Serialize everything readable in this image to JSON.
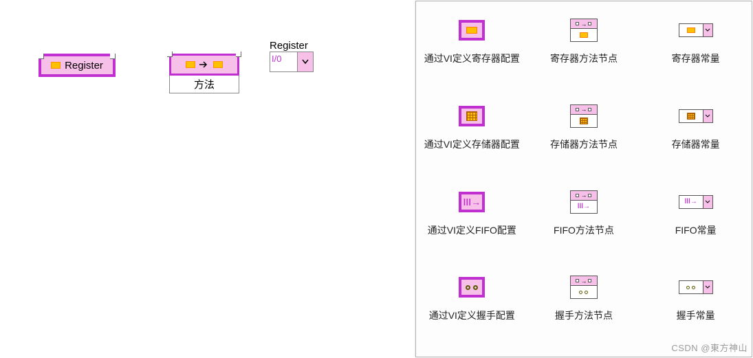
{
  "canvas": {
    "register_node": {
      "label": "Register",
      "icon": "register-icon"
    },
    "method_node": {
      "top_icon": "register-icon",
      "bottom_label": "方法"
    },
    "register_constant": {
      "title": "Register",
      "value_placeholder": "I/0"
    }
  },
  "palette": {
    "items": [
      {
        "id": "config-register",
        "label": "通过VI定义寄存器配置",
        "icon": "config-register"
      },
      {
        "id": "method-register",
        "label": "寄存器方法节点",
        "icon": "method-register"
      },
      {
        "id": "const-register",
        "label": "寄存器常量",
        "icon": "const-register"
      },
      {
        "id": "config-memory",
        "label": "通过VI定义存储器配置",
        "icon": "config-memory"
      },
      {
        "id": "method-memory",
        "label": "存储器方法节点",
        "icon": "method-memory"
      },
      {
        "id": "const-memory",
        "label": "存储器常量",
        "icon": "const-memory"
      },
      {
        "id": "config-fifo",
        "label": "通过VI定义FIFO配置",
        "icon": "config-fifo"
      },
      {
        "id": "method-fifo",
        "label": "FIFO方法节点",
        "icon": "method-fifo"
      },
      {
        "id": "const-fifo",
        "label": "FIFO常量",
        "icon": "const-fifo"
      },
      {
        "id": "config-handshake",
        "label": "通过VI定义握手配置",
        "icon": "config-handshake"
      },
      {
        "id": "method-handshake",
        "label": "握手方法节点",
        "icon": "method-handshake"
      },
      {
        "id": "const-handshake",
        "label": "握手常量",
        "icon": "const-handshake"
      }
    ]
  },
  "watermark": "CSDN @東方神山"
}
